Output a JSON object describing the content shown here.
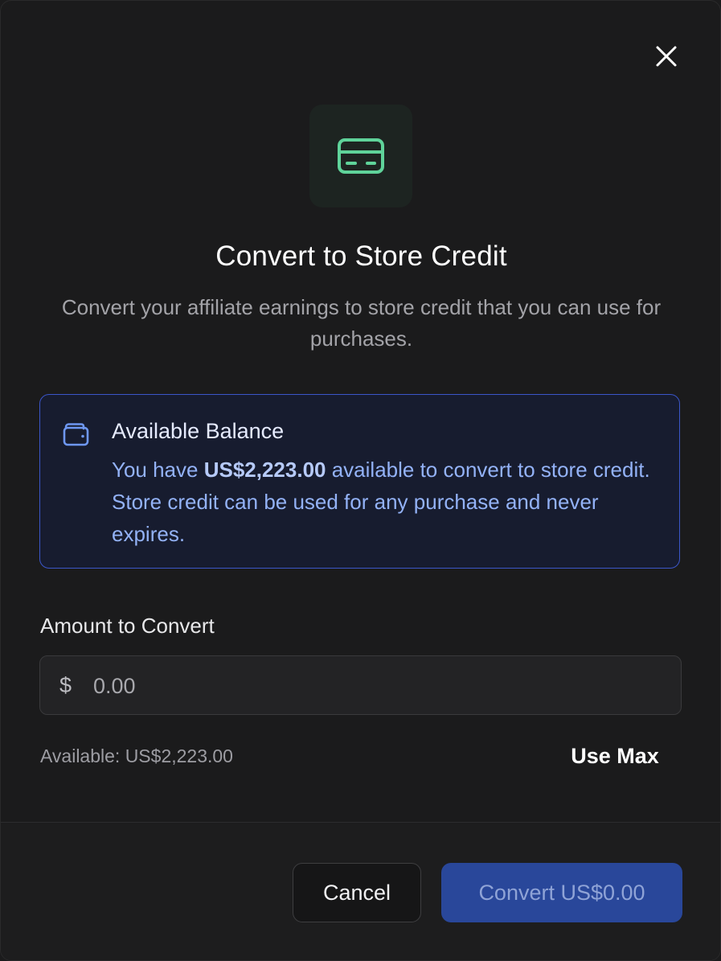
{
  "dialog": {
    "title": "Convert to Store Credit",
    "subtitle": "Convert your affiliate earnings to store credit that you can use for purchases.",
    "close_icon": "close-icon",
    "hero_icon": "credit-card-icon"
  },
  "balance_info": {
    "icon": "wallet-icon",
    "title": "Available Balance",
    "text_before": "You have ",
    "amount": "US$2,223.00",
    "text_after": " available to convert to store credit. Store credit can be used for any purchase and never expires."
  },
  "amount_field": {
    "label": "Amount to Convert",
    "currency_symbol": "$",
    "placeholder": "0.00",
    "value": ""
  },
  "available_text": "Available: US$2,223.00",
  "use_max_label": "Use Max",
  "footer": {
    "cancel_label": "Cancel",
    "convert_label": "Convert US$0.00",
    "convert_enabled": false
  },
  "colors": {
    "background": "#1b1b1c",
    "accent_green": "#5fd39a",
    "info_border": "#3b56c9",
    "info_text": "#93b2f7",
    "primary_button": "#29479a"
  }
}
